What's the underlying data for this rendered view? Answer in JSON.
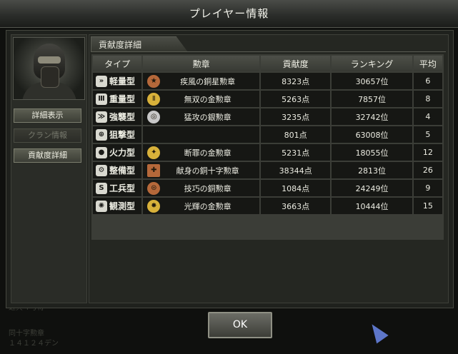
{
  "window": {
    "title": "プレイヤー情報"
  },
  "sidebar": {
    "buttons": [
      {
        "label": "詳細表示",
        "enabled": true
      },
      {
        "label": "クラン情報",
        "enabled": false
      },
      {
        "label": "貢献度詳細",
        "enabled": true
      }
    ]
  },
  "section": {
    "title": "貢献度詳細"
  },
  "table": {
    "headers": [
      "タイプ",
      "勲章",
      "貢献度",
      "ランキング",
      "平均"
    ],
    "rows": [
      {
        "type": "軽量型",
        "type_icon": "light-type-icon",
        "medal": "疾風の銅星勲章",
        "medal_icon": "bronze-star-medal-icon",
        "contribution": "8323点",
        "ranking": "30657位",
        "average": "6"
      },
      {
        "type": "重量型",
        "type_icon": "heavy-type-icon",
        "medal": "無双の金勲章",
        "medal_icon": "gold-medal-icon",
        "contribution": "5263点",
        "ranking": "7857位",
        "average": "8"
      },
      {
        "type": "強襲型",
        "type_icon": "assault-type-icon",
        "medal": "猛攻の銀勲章",
        "medal_icon": "silver-medal-icon",
        "contribution": "3235点",
        "ranking": "32742位",
        "average": "4"
      },
      {
        "type": "狙撃型",
        "type_icon": "sniper-type-icon",
        "medal": "",
        "medal_icon": "",
        "contribution": "801点",
        "ranking": "63008位",
        "average": "5"
      },
      {
        "type": "火力型",
        "type_icon": "firepower-type-icon",
        "medal": "断罪の金勲章",
        "medal_icon": "gold-medal-icon",
        "contribution": "5231点",
        "ranking": "18055位",
        "average": "12"
      },
      {
        "type": "整備型",
        "type_icon": "maintenance-type-icon",
        "medal": "献身の銅十字勲章",
        "medal_icon": "bronze-cross-medal-icon",
        "contribution": "38344点",
        "ranking": "2813位",
        "average": "26"
      },
      {
        "type": "工兵型",
        "type_icon": "engineer-type-icon",
        "medal": "技巧の銅勲章",
        "medal_icon": "bronze-medal-icon",
        "contribution": "1084点",
        "ranking": "24249位",
        "average": "9"
      },
      {
        "type": "観測型",
        "type_icon": "observer-type-icon",
        "medal": "光輝の金勲章",
        "medal_icon": "gold-medal-icon",
        "contribution": "3663点",
        "ranking": "10444位",
        "average": "15"
      }
    ]
  },
  "footer": {
    "ok_label": "OK"
  },
  "background_text": [
    "近兵４号得",
    "同十字勲章",
    "１４１２４デン"
  ],
  "colors": {
    "gold": "#d8b13a",
    "silver": "#c8c8c8",
    "bronze": "#b5683a",
    "accent": "#5d76c9"
  }
}
